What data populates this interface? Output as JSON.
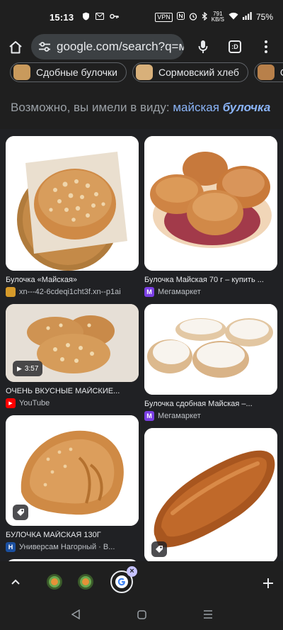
{
  "status": {
    "time": "15:13",
    "vpn": "VPN",
    "net_speed_value": "791",
    "net_speed_unit": "KB/S",
    "battery": "75%"
  },
  "browser": {
    "url": "google.com/search?q=ма",
    "tab_count": ":D"
  },
  "chips": [
    {
      "label": "Сдобные булочки",
      "thumb_color": "#c99a5c"
    },
    {
      "label": "Сормовский хлеб",
      "thumb_color": "#d8b07a"
    },
    {
      "label": "Сд",
      "thumb_color": "#b8804a"
    }
  ],
  "did_you_mean": {
    "prefix": "Возможно, вы имели в виду:",
    "plain": "майская",
    "emphasis": "булочка"
  },
  "results": {
    "left": [
      {
        "caption": "Булочка «Майская»",
        "source": "xn---42-6cdeqi1cht3f.xn--p1ai",
        "favicon": "",
        "fav_color": "#d69a2a"
      },
      {
        "caption": "ОЧЕНЬ ВКУСНЫЕ МАЙСКИЕ...",
        "source": "YouTube",
        "favicon": "▶",
        "fav_color": "#ff0000",
        "duration": "3:57"
      },
      {
        "caption": "БУЛОЧКА МАЙСКАЯ 130Г",
        "source": "Универсам Нагорный · В...",
        "favicon": "H",
        "fav_color": "#1a4fa0"
      }
    ],
    "right": [
      {
        "caption": "Булочка Майская 70 г – купить ...",
        "source": "Мегамаркет",
        "favicon": "M",
        "fav_color": "#7b3fe4"
      },
      {
        "caption": "Булочка сдобная Майская –...",
        "source": "Мегамаркет",
        "favicon": "M",
        "fav_color": "#7b3fe4"
      }
    ]
  },
  "colors": {
    "background": "#202124",
    "toolbar": "#1f1f1f",
    "link": "#8ab4f8",
    "muted_text": "#9aa0a6"
  }
}
